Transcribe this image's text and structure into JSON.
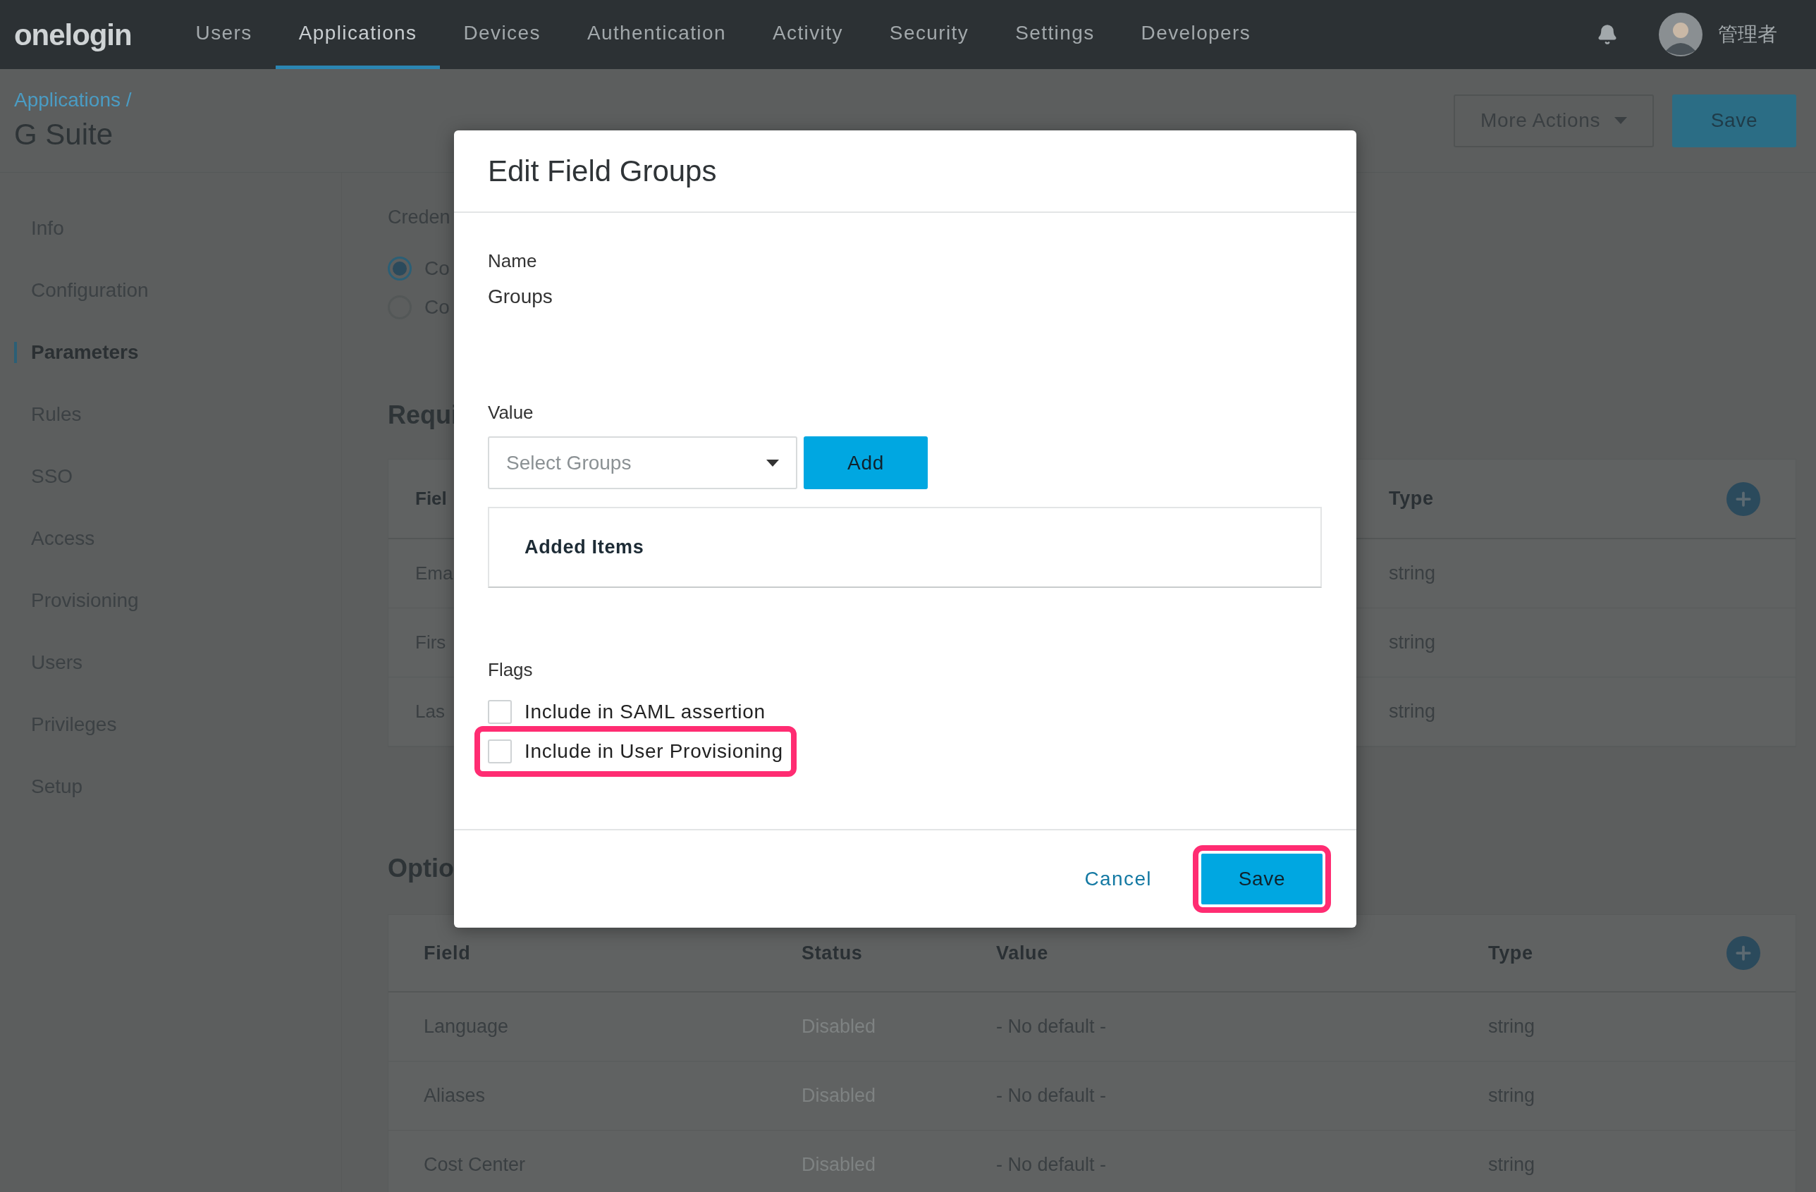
{
  "top_nav": {
    "logo": "onelogin",
    "items": [
      {
        "label": "Users",
        "selected": false
      },
      {
        "label": "Applications",
        "selected": true
      },
      {
        "label": "Devices",
        "selected": false
      },
      {
        "label": "Authentication",
        "selected": false
      },
      {
        "label": "Activity",
        "selected": false
      },
      {
        "label": "Security",
        "selected": false
      },
      {
        "label": "Settings",
        "selected": false
      },
      {
        "label": "Developers",
        "selected": false
      }
    ],
    "user": {
      "name": "管理者"
    }
  },
  "header": {
    "breadcrumb": "Applications /",
    "title": "G Suite",
    "buttons": [
      {
        "label": "More Actions",
        "kind": "dropdown"
      },
      {
        "label": "Save",
        "kind": "primary"
      }
    ]
  },
  "sidebar": {
    "items": [
      {
        "label": "Info",
        "selected": false
      },
      {
        "label": "Configuration",
        "selected": false
      },
      {
        "label": "Parameters",
        "selected": true
      },
      {
        "label": "Rules",
        "selected": false
      },
      {
        "label": "SSO",
        "selected": false
      },
      {
        "label": "Access",
        "selected": false
      },
      {
        "label": "Provisioning",
        "selected": false
      },
      {
        "label": "Users",
        "selected": false
      },
      {
        "label": "Privileges",
        "selected": false
      },
      {
        "label": "Setup",
        "selected": false
      }
    ]
  },
  "credentials": {
    "heading": "Creden",
    "options": [
      {
        "label": "Co",
        "selected": true
      },
      {
        "label": "Co",
        "selected": false
      }
    ]
  },
  "required": {
    "heading": "Requi",
    "columns": [
      "Fiel",
      "Type"
    ],
    "rows": [
      {
        "field": "Ema",
        "type": "string"
      },
      {
        "field": "Firs",
        "type": "string"
      },
      {
        "field": "Las",
        "type": "string"
      }
    ]
  },
  "optional": {
    "heading": "Optio",
    "columns": [
      "Field",
      "Status",
      "Value",
      "Type"
    ],
    "rows": [
      {
        "field": "Language",
        "status": "Disabled",
        "value": "- No default -",
        "type": "string"
      },
      {
        "field": "Aliases",
        "status": "Disabled",
        "value": "- No default -",
        "type": "string"
      },
      {
        "field": "Cost Center",
        "status": "Disabled",
        "value": "- No default -",
        "type": "string"
      }
    ]
  },
  "dialog": {
    "title": "Edit Field Groups",
    "name_label": "Name",
    "name_value": "Groups",
    "value_label": "Value",
    "select": {
      "placeholder": "Select Groups"
    },
    "add_button": "Add",
    "added_items": {
      "heading": "Added Items"
    },
    "flags_label": "Flags",
    "flags": [
      {
        "label": "Include in SAML assertion",
        "checked": false,
        "highlighted": false
      },
      {
        "label": "Include in User Provisioning",
        "checked": false,
        "highlighted": true
      }
    ],
    "cancel": "Cancel",
    "save": {
      "label": "Save",
      "highlighted": true
    }
  }
}
